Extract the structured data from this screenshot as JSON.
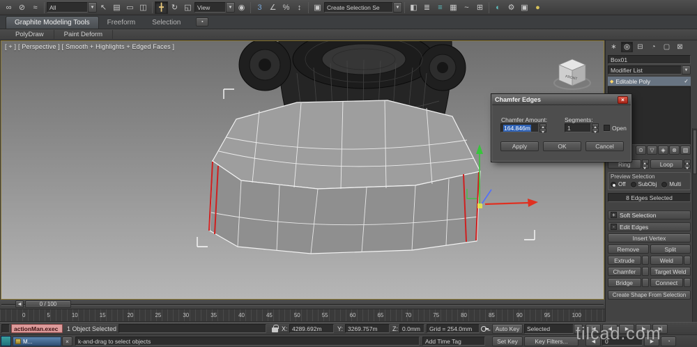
{
  "icons": {
    "link": "∞",
    "unlink": "⊘",
    "bind": "≈",
    "arrow_down": "▼",
    "cursor": "↖",
    "by_name": "▤",
    "region": "▭",
    "crossing": "◫",
    "move": "╋",
    "rotate": "↻",
    "scale": "◱",
    "center": "◉",
    "snap": "3",
    "angle_snap": "∠",
    "percent_snap": "%",
    "spinner_snap": "↕",
    "edit_sets": "▣",
    "mirror": "◧",
    "align": "≣",
    "layers": "≡",
    "ribbon": "▦",
    "curve": "~",
    "schematic": "⊞",
    "material": "◐",
    "render_setup": "⚙",
    "rfw": "▣",
    "render": "●",
    "close": "×",
    "plus": "+",
    "minus": "-",
    "check": "✓",
    "tab_create": "∗",
    "tab_modify": "◎",
    "tab_hierarchy": "⊟",
    "tab_motion": "◔",
    "tab_display": "▢",
    "tab_utilities": "⊠",
    "pin": "⊙",
    "show_end": "▽",
    "unique": "◈",
    "remove_mod": "⊗",
    "configure": "▥",
    "poly": "◆",
    "minimize_ribbon": "▪",
    "go_start": "|◀",
    "prev_frame": "◀|",
    "play": "▶",
    "next_frame": "|▶",
    "go_end": "▶|",
    "prev_key": "◀",
    "next_key": "▶",
    "time_config": "◔"
  },
  "toolbar": {
    "filter_value": "All",
    "coord_system_value": "View",
    "selection_set_value": "Create Selection Se"
  },
  "ribbon": {
    "tab1": "Graphite Modeling Tools",
    "tab2": "Freeform",
    "tab3": "Selection",
    "subtab1": "PolyDraw",
    "subtab2": "Paint Deform"
  },
  "viewport": {
    "label": "[ + ] [ Perspective ] [ Smooth + Highlights + Edged Faces ]",
    "viewcube_label": "FRONT"
  },
  "dialog": {
    "title": "Chamfer Edges",
    "amount_label": "Chamfer Amount:",
    "amount_value": "164.846m",
    "segments_label": "Segments:",
    "segments_value": "1",
    "open_label": "Open",
    "apply_label": "Apply",
    "ok_label": "OK",
    "cancel_label": "Cancel"
  },
  "panel": {
    "object_name": "Box01",
    "modifier_list_label": "Modifier List",
    "stack_selected": "Editable Poly",
    "ring_label": "Ring",
    "loop_label": "Loop",
    "preview_selection_label": "Preview Selection",
    "preview_off": "Off",
    "preview_subobj": "SubObj",
    "preview_multi": "Multi",
    "selection_info": "8 Edges Selected",
    "soft_selection_label": "Soft Selection",
    "soft_toggle": "+",
    "edit_edges_label": "Edit Edges",
    "edit_toggle": "-",
    "insert_vertex": "Insert Vertex",
    "remove": "Remove",
    "split": "Split",
    "extrude": "Extrude",
    "weld": "Weld",
    "chamfer": "Chamfer",
    "target_weld": "Target Weld",
    "bridge": "Bridge",
    "connect": "Connect",
    "create_shape": "Create Shape From Selection"
  },
  "timeline": {
    "slider_label": "0 / 100",
    "ticks": [
      "0",
      "5",
      "10",
      "15",
      "20",
      "25",
      "30",
      "35",
      "40",
      "45",
      "50",
      "55",
      "60",
      "65",
      "70",
      "75",
      "80",
      "85",
      "90",
      "95",
      "100"
    ]
  },
  "status": {
    "maxscript_text": "actionMan.exec",
    "selection_text": "1 Object Selected",
    "x_label": "X:",
    "x_value": "4289.692m",
    "y_label": "Y:",
    "y_value": "3269.757m",
    "z_label": "Z:",
    "z_value": "0.0mm",
    "grid_text": "Grid = 254.0mm",
    "auto_key": "Auto Key",
    "selected_dropdown": "Selected",
    "set_key": "Set Key",
    "key_filters": "Key Filters...",
    "prompt": "k-and-drag to select objects",
    "add_time_tag": "Add Time Tag",
    "frame_value": "0",
    "window_title": "M...",
    "watermark": "tilcad.com"
  }
}
